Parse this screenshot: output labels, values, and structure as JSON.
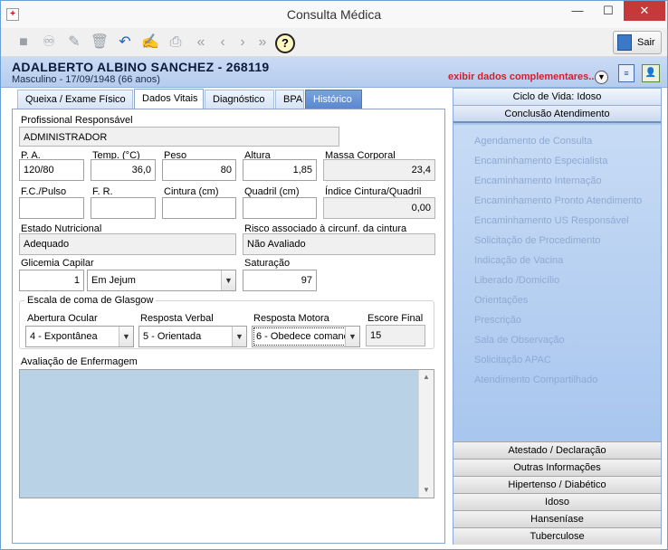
{
  "window": {
    "title": "Consulta Médica",
    "minimize": "—",
    "maximize": "☐",
    "close": "✕"
  },
  "toolbar": {
    "sair_label": "Sair",
    "help_label": "?"
  },
  "patient": {
    "name_line": "ADALBERTO ALBINO SANCHEZ - 268119",
    "sub_line": "Masculino - 17/09/1948 (66 anos)",
    "more_link": "exibir dados complementares..."
  },
  "tabs": [
    {
      "label": "Queixa / Exame Físico"
    },
    {
      "label": "Dados Vitais"
    },
    {
      "label": "Diagnóstico"
    },
    {
      "label": "BPA"
    },
    {
      "label": "Histórico"
    }
  ],
  "form": {
    "profissional_label": "Profissional Responsável",
    "profissional_value": "ADMINISTRADOR",
    "pa_label": "P. A.",
    "pa_value": "120/80",
    "temp_label": "Temp. (°C)",
    "temp_value": "36,0",
    "peso_label": "Peso",
    "peso_value": "80",
    "altura_label": "Altura",
    "altura_value": "1,85",
    "massa_label": "Massa Corporal",
    "massa_value": "23,4",
    "fc_label": "F.C./Pulso",
    "fc_value": "",
    "fr_label": "F. R.",
    "fr_value": "",
    "cintura_label": "Cintura (cm)",
    "cintura_value": "",
    "quadril_label": "Quadril (cm)",
    "quadril_value": "",
    "indice_label": "Índice Cintura/Quadril",
    "indice_value": "0,00",
    "estado_label": "Estado Nutricional",
    "estado_value": "Adequado",
    "risco_label": "Risco associado à circunf. da cintura",
    "risco_value": "Não Avaliado",
    "glicemia_label": "Glicemia Capilar",
    "glicemia_value": "1",
    "glicemia_option": "Em Jejum",
    "saturacao_label": "Saturação",
    "saturacao_value": "97",
    "glasgow_title": "Escala de coma de Glasgow",
    "ocular_label": "Abertura Ocular",
    "ocular_value": "4 - Expontânea",
    "verbal_label": "Resposta Verbal",
    "verbal_value": "5 - Orientada",
    "motora_label": "Resposta Motora",
    "motora_value": "6 - Obedece comand",
    "escore_label": "Escore Final",
    "escore_value": "15",
    "avaliacao_label": "Avaliação de Enfermagem"
  },
  "sidebar": {
    "ciclo": "Ciclo de Vida: Idoso",
    "conclusao": "Conclusão Atendimento",
    "items": [
      "Agendamento de Consulta",
      "Encaminhamento Especialista",
      "Encaminhamento Internação",
      "Encaminhamento Pronto Atendimento",
      "Encaminhamento US Responsável",
      "Solicitação de Procedimento",
      "Indicação de Vacina",
      "Liberado /Domicílio",
      "Orientações",
      "Prescrição",
      "Sala de Observação",
      "Solicitação APAC",
      "Atendimento Compartilhado"
    ],
    "bottom": [
      "Atestado / Declaração",
      "Outras Informações",
      "Hipertenso / Diabético",
      "Idoso",
      "Hanseníase",
      "Tuberculose"
    ]
  },
  "colors": {
    "accent": "#a9c6ee",
    "link_red": "#d0202a",
    "tab_history": "#5a88cf"
  }
}
